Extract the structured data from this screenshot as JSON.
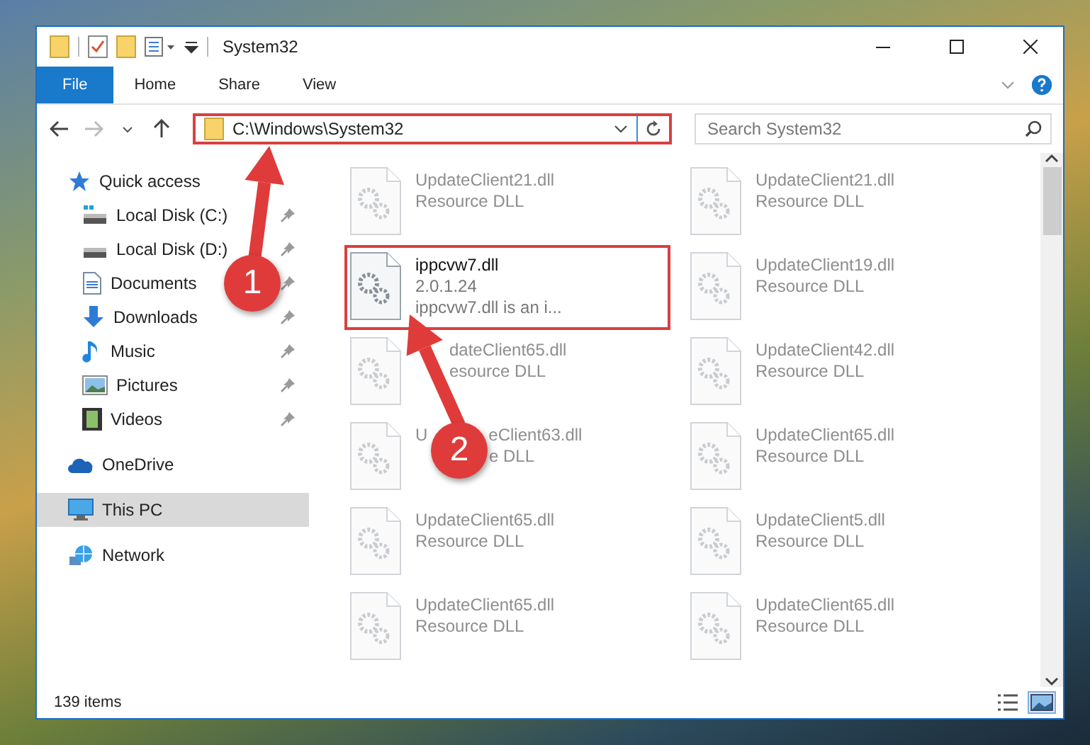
{
  "window": {
    "title": "System32"
  },
  "ribbon": {
    "tabs": [
      {
        "label": "File",
        "selected": true
      },
      {
        "label": "Home",
        "selected": false
      },
      {
        "label": "Share",
        "selected": false
      },
      {
        "label": "View",
        "selected": false
      }
    ]
  },
  "address_bar": {
    "path": "C:\\Windows\\System32",
    "highlighted": true
  },
  "search": {
    "placeholder": "Search System32"
  },
  "sidebar": {
    "items": [
      {
        "label": "Quick access",
        "kind": "star",
        "selected": false,
        "children": [
          {
            "label": "Local Disk (C:)",
            "kind": "drive-c",
            "selected": false,
            "pinned": true
          },
          {
            "label": "Local Disk (D:)",
            "kind": "drive",
            "selected": false,
            "pinned": true
          },
          {
            "label": "Documents",
            "kind": "documents",
            "selected": false,
            "pinned": true
          },
          {
            "label": "Downloads",
            "kind": "downloads",
            "selected": false,
            "pinned": true
          },
          {
            "label": "Music",
            "kind": "music",
            "selected": false,
            "pinned": true
          },
          {
            "label": "Pictures",
            "kind": "pictures",
            "selected": false,
            "pinned": true
          },
          {
            "label": "Videos",
            "kind": "videos",
            "selected": false,
            "pinned": true
          }
        ]
      },
      {
        "label": "OneDrive",
        "kind": "cloud",
        "selected": false
      },
      {
        "label": "This PC",
        "kind": "pc",
        "selected": true
      },
      {
        "label": "Network",
        "kind": "network",
        "selected": false
      }
    ]
  },
  "files": [
    {
      "name": "UpdateClient21.dll",
      "lines": [
        "Resource DLL"
      ],
      "faded": true,
      "highlighted": false
    },
    {
      "name": "UpdateClient21.dll",
      "lines": [
        "Resource DLL"
      ],
      "faded": true,
      "highlighted": false
    },
    {
      "name": "ippcvw7.dll",
      "lines": [
        "2.0.1.24",
        "ippcvw7.dll is an i..."
      ],
      "faded": false,
      "highlighted": true
    },
    {
      "name": "UpdateClient19.dll",
      "lines": [
        "Resource DLL"
      ],
      "faded": true,
      "highlighted": false
    },
    {
      "name": "dateClient65.dll",
      "lines": [
        "esource DLL"
      ],
      "faded": true,
      "highlighted": false
    },
    {
      "name": "UpdateClient42.dll",
      "lines": [
        "Resource DLL"
      ],
      "faded": true,
      "highlighted": false
    },
    {
      "lead": "U",
      "name": "eClient63.dll",
      "lines": [
        "e DLL"
      ],
      "faded": true,
      "highlighted": false
    },
    {
      "name": "UpdateClient65.dll",
      "lines": [
        "Resource DLL"
      ],
      "faded": true,
      "highlighted": false
    },
    {
      "name": "UpdateClient65.dll",
      "lines": [
        "Resource DLL"
      ],
      "faded": true,
      "highlighted": false
    },
    {
      "name": "UpdateClient5.dll",
      "lines": [
        "Resource DLL"
      ],
      "faded": true,
      "highlighted": false
    },
    {
      "name": "UpdateClient65.dll",
      "lines": [
        "Resource DLL"
      ],
      "faded": true,
      "highlighted": false
    },
    {
      "name": "UpdateClient65.dll",
      "lines": [
        "Resource DLL"
      ],
      "faded": true,
      "highlighted": false
    }
  ],
  "status_bar": {
    "item_count": "139 items"
  },
  "annotations": [
    {
      "label": "1"
    },
    {
      "label": "2"
    }
  ]
}
